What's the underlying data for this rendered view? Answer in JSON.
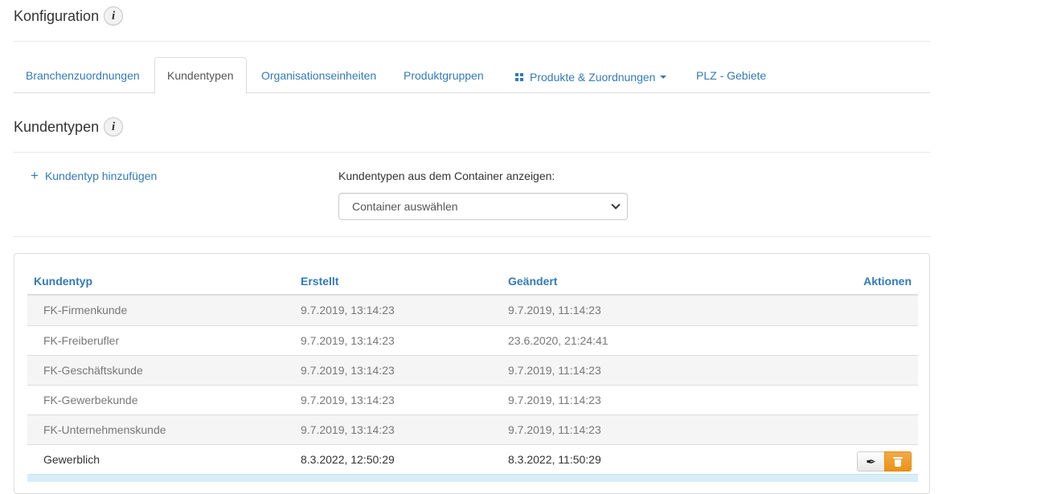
{
  "page": {
    "title": "Konfiguration"
  },
  "tabs": [
    {
      "label": "Branchenzuordnungen"
    },
    {
      "label": "Kundentypen"
    },
    {
      "label": "Organisationseinheiten"
    },
    {
      "label": "Produktgruppen"
    },
    {
      "label": "Produkte & Zuordnungen"
    },
    {
      "label": "PLZ - Gebiete"
    }
  ],
  "section": {
    "title": "Kundentypen"
  },
  "toolbar": {
    "add_label": "Kundentyp hinzufügen",
    "container_label": "Kundentypen aus dem Container anzeigen:",
    "container_select": "Container auswählen"
  },
  "table": {
    "headers": [
      "Kundentyp",
      "Erstellt",
      "Geändert",
      "Aktionen"
    ],
    "rows": [
      {
        "name": "FK-Firmenkunde",
        "created": "9.7.2019, 13:14:23",
        "changed": "9.7.2019, 11:14:23"
      },
      {
        "name": "FK-Freiberufler",
        "created": "9.7.2019, 13:14:23",
        "changed": "23.6.2020, 21:24:41"
      },
      {
        "name": "FK-Geschäftskunde",
        "created": "9.7.2019, 13:14:23",
        "changed": "9.7.2019, 11:14:23"
      },
      {
        "name": "FK-Gewerbekunde",
        "created": "9.7.2019, 13:14:23",
        "changed": "9.7.2019, 11:14:23"
      },
      {
        "name": "FK-Unternehmenskunde",
        "created": "9.7.2019, 13:14:23",
        "changed": "9.7.2019, 11:14:23"
      },
      {
        "name": "Gewerblich",
        "created": "8.3.2022, 12:50:29",
        "changed": "8.3.2022, 11:50:29"
      }
    ]
  },
  "icons": {
    "info": "info-icon",
    "add": "plus-icon",
    "grid": "grid-icon",
    "edit": "quill-icon",
    "delete": "trash-icon"
  },
  "colors": {
    "link": "#337ab7",
    "delete_button": "#eb9316",
    "row_stripe": "#f5f5f5",
    "selected_row": "#d9edf7"
  }
}
